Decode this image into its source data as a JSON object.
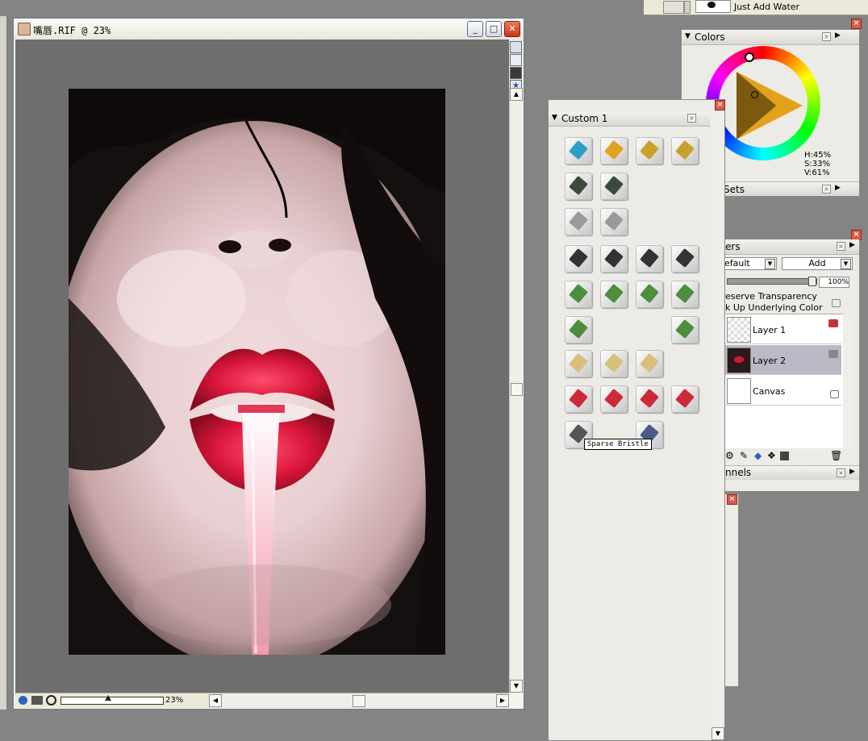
{
  "top_toolbar": {
    "variant_label": "Just Add Water"
  },
  "document": {
    "title": "嘴唇.RIF @ 23%",
    "zoom": "23%",
    "window_buttons": {
      "minimize": "_",
      "maximize": "□",
      "close": "✕"
    }
  },
  "custom_palette": {
    "title": "Custom 1",
    "tooltip": "Sparse Bristle",
    "icon_rows": [
      [
        "colored-pencil-icon",
        "pencil-icon",
        "eraser-pencil-icon",
        "eraser-pencil-icon"
      ],
      [
        "sharpener-icon",
        "sharpener-icon"
      ],
      [
        "blender-icon",
        "blender-icon"
      ],
      [
        "camera-icon",
        "camera-icon",
        "camera-icon",
        "camera-icon"
      ],
      [
        "paint-cup-icon",
        "paint-cup-icon",
        "paint-cup-icon",
        "paint-cup-icon"
      ],
      [
        "paint-cup-icon",
        "paint-cup-icon"
      ],
      [
        "flat-brush-icon",
        "flat-brush-icon",
        "flat-brush-icon"
      ],
      [
        "tri-color-brush-icon",
        "tri-color-brush-icon",
        "tri-color-brush-icon",
        "tri-color-brush-icon"
      ],
      [
        "airbrush-icon",
        "knife-icon"
      ]
    ]
  },
  "colors_palette": {
    "title": "Colors",
    "hsv": {
      "h": "H:45%",
      "s": "S:33%",
      "v": "V:61%"
    },
    "sets_label": "Sets",
    "main_color": "#9c8a68"
  },
  "layers_palette": {
    "title": "ers",
    "composite_method": "efault",
    "composite_depth": "Add",
    "opacity": "100%",
    "preserve_transparency": "eserve Transparency",
    "pick_up_color": "k Up Underlying Color",
    "layers": [
      {
        "name": "Layer 1",
        "selected": false
      },
      {
        "name": "Layer 2",
        "selected": true
      },
      {
        "name": "Canvas",
        "selected": false
      }
    ],
    "channels_label": "nnels"
  }
}
